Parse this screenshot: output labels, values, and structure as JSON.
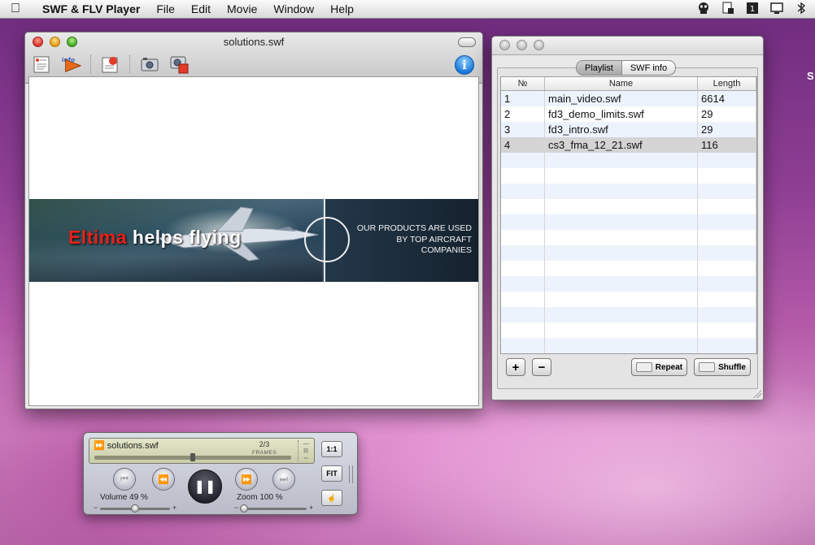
{
  "menubar": {
    "app_name": "SWF & FLV Player",
    "items": [
      "File",
      "Edit",
      "Movie",
      "Window",
      "Help"
    ]
  },
  "desktop": {
    "edge_letter": "S"
  },
  "player_window": {
    "title": "solutions.swf",
    "toolbar_icons": [
      "open-file-icon",
      "playback-arrow-icon",
      "settings-icon",
      "screenshot-camera-icon",
      "record-camera-icon"
    ],
    "info_label": "i",
    "banner": {
      "slogan_red": "Eltima",
      "slogan_white": " helps flying",
      "tagline_1": "OUR PRODUCTS ARE USED",
      "tagline_2": "BY TOP AIRCRAFT",
      "tagline_3": "COMPANIES"
    }
  },
  "playlist_window": {
    "tabs": [
      "Playlist",
      "SWF info"
    ],
    "active_tab": "Playlist",
    "columns": [
      "№",
      "Name",
      "Length"
    ],
    "rows": [
      {
        "num": "1",
        "name": "main_video.swf",
        "length": "6614"
      },
      {
        "num": "2",
        "name": "fd3_demo_limits.swf",
        "length": "29"
      },
      {
        "num": "3",
        "name": "fd3_intro.swf",
        "length": "29"
      },
      {
        "num": "4",
        "name": "cs3_fma_12_21.swf",
        "length": "116"
      }
    ],
    "selected_row": 4,
    "add_label": "+",
    "remove_label": "−",
    "repeat_label": "Repeat",
    "shuffle_label": "Shuffle"
  },
  "controller": {
    "filename": "solutions.swf",
    "frames_count": "2/3",
    "frames_label": "FRAMES",
    "progress_fraction": 0.5,
    "volume_label": "Volume 49 %",
    "volume_fraction": 0.49,
    "zoom_label": "Zoom 100 %",
    "zoom_fraction": 0.05,
    "btn_1to1": "1:1",
    "btn_fit": "FIT",
    "minus": "−",
    "plus": "+"
  }
}
